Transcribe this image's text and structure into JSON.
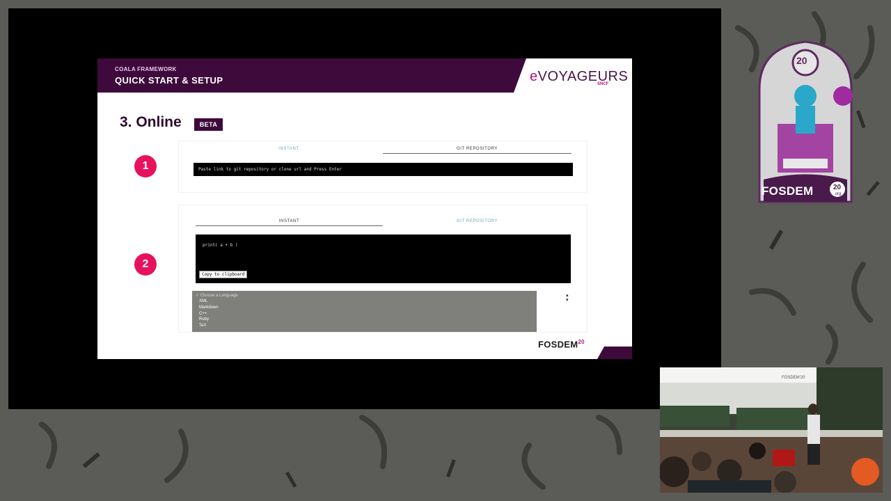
{
  "slide": {
    "header_small": "COALA FRAMEWORK",
    "header_big": "QUICK START & SETUP",
    "brand_e": "e",
    "brand_rest": "VOYAGEURS",
    "brand_sub": "SNCF",
    "section_title": "3. Online",
    "beta_label": "BETA",
    "steps": [
      {
        "number": "1",
        "tabs": [
          {
            "label": "INSTANT",
            "state": "inactive"
          },
          {
            "label": "GIT REPOSITORY",
            "state": "active"
          }
        ],
        "input_placeholder": "Paste link to git repository or clone url and Press Enter"
      },
      {
        "number": "2",
        "tabs": [
          {
            "label": "INSTANT",
            "state": "active"
          },
          {
            "label": "GIT REPOSITORY",
            "state": "inactive"
          }
        ],
        "code": "print( a + b )",
        "copy_label": "Copy to clipboard",
        "language_select": {
          "header": "✓ Choose a Language",
          "options": [
            "XML",
            "Markdown",
            "C++",
            "Ruby",
            "TeX"
          ]
        }
      }
    ],
    "footer_logo": "FOSDEM",
    "footer_logo_sup": "20"
  },
  "badge": {
    "year": "20",
    "label": "FOSDEM",
    "sup": "20",
    "org": ".org"
  },
  "camera": {
    "screen_text": "FOSDEM'20"
  },
  "colors": {
    "header_purple": "#3e0a3c",
    "accent_magenta": "#b2137f",
    "step_pink": "#e8115d",
    "tab_inactive_teal": "#69a8b4"
  }
}
